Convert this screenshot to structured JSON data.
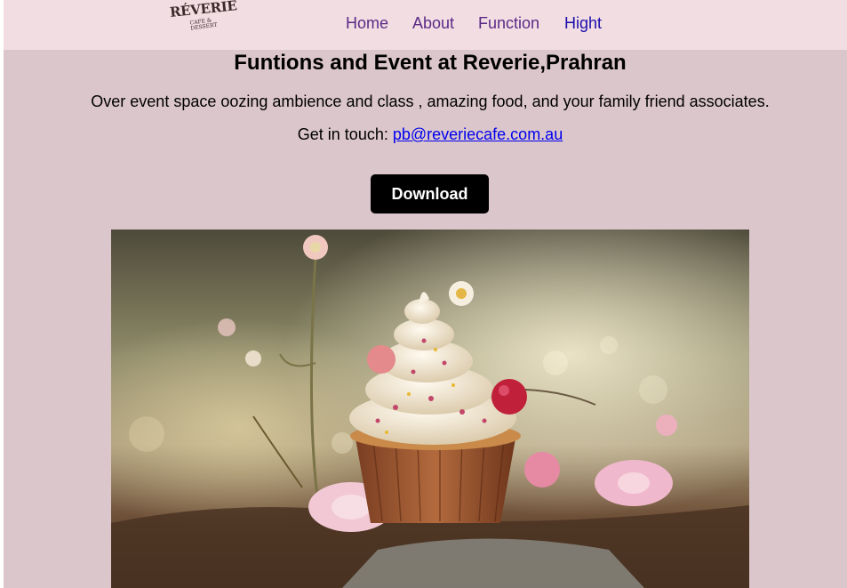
{
  "nav": {
    "logo_main": "RÉVERIE",
    "logo_sub": "CAFE & DESSERT",
    "items": [
      {
        "label": "Home"
      },
      {
        "label": "About"
      },
      {
        "label": "Function"
      },
      {
        "label": "Hight"
      }
    ]
  },
  "main": {
    "title": "Funtions and Event at Reverie,Prahran",
    "description": "Over event space oozing ambience and class , amazing food, and your family friend associates.",
    "contact_prefix": "Get in touch: ",
    "contact_email": "pb@reveriecafe.com.au",
    "download_label": "Download"
  },
  "colors": {
    "page_background": "#dbc6cb",
    "nav_background": "#f2dde2",
    "nav_link": "#5b2a86",
    "nav_link_active": "#1a0dab",
    "button_background": "#000000"
  },
  "icons": {
    "logo": "reverie-logo-icon",
    "hero": "cupcake-photo"
  }
}
